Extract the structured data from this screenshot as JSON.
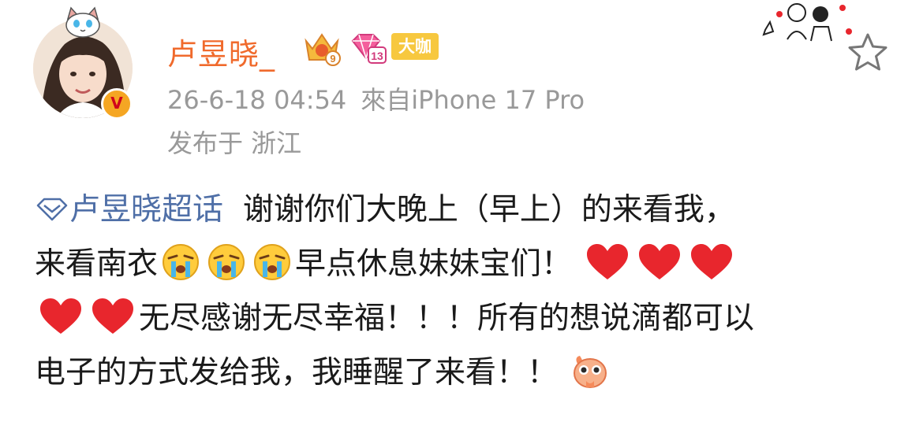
{
  "post": {
    "author": {
      "name": "卢昱晓_",
      "crown_level": "9",
      "diamond_level": "13",
      "badge": "大咖",
      "verified_mark": "V"
    },
    "timestamp": "26-6-18 04:54",
    "source": "來自iPhone 17 Pro",
    "location": "发布于 浙江",
    "content": {
      "topic": "卢昱晓超话",
      "line1_text": "谢谢你们大晚上（早上）的来看我，",
      "line2_text": "来看南衣",
      "line2_text_b": "早点休息妹妹宝们！",
      "line3_text": "无尽感谢无尽幸福！！！所有的想说滴都可以",
      "line4_text": "电子的方式发给我，我睡醒了来看！！"
    },
    "icons": {
      "favorite": "star-outline-icon",
      "topic": "super-topic-diamond-icon",
      "crying": "crying-emoji-icon",
      "heart": "red-heart-icon",
      "mascot": "mascot-pray-icon"
    },
    "colors": {
      "username": "#f06a2c",
      "topic": "#4f6fa7",
      "meta": "#999999",
      "heart": "#e8262d",
      "badge": "#f7c83f"
    }
  }
}
